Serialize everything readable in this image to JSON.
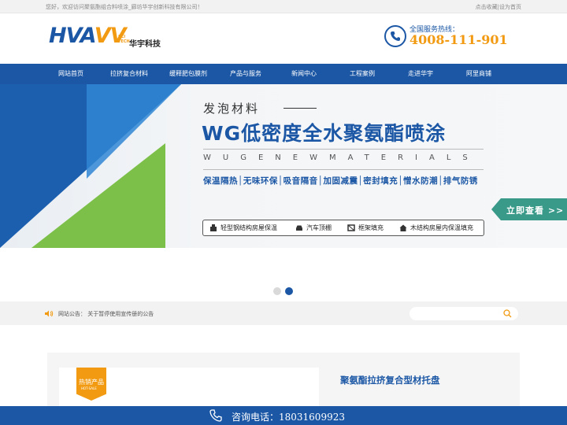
{
  "topbar": {
    "welcome": "您好，欢迎访问聚氨酯组合料喷涂_廊坊华宇创新科技有限公司！",
    "favorite": "点击收藏|设为首页"
  },
  "logo": {
    "brand_a": "HVA",
    "brand_b": "VV",
    "sci_line1": "SCI",
    "sci_line2": "TECH",
    "cn_name": "华宇科技"
  },
  "hotline": {
    "label": "全国服务热线：",
    "number": "4008-111-901"
  },
  "nav": {
    "items": [
      {
        "label": "网站首页"
      },
      {
        "label": "拉挤复合材料"
      },
      {
        "label": "缓释肥包膜剂"
      },
      {
        "label": "产品与服务"
      },
      {
        "label": "新闻中心"
      },
      {
        "label": "工程案例"
      },
      {
        "label": "走进华宇"
      },
      {
        "label": "阿里商铺"
      }
    ]
  },
  "banner": {
    "subtitle": "发泡材料",
    "title": "WG低密度全水聚氨酯喷涂",
    "english": "WUGENEWMATERIALS",
    "features": "保温隔热│无味环保│吸音隔音│加固减震│密封填充│憎水防潮│排气防锈",
    "applications": [
      {
        "label": "轻型钢结构房屋保温",
        "icon": "building-icon"
      },
      {
        "label": "汽车顶棚",
        "icon": "car-icon"
      },
      {
        "label": "框架填充",
        "icon": "frame-icon"
      },
      {
        "label": "木结构房屋内保温填充",
        "icon": "house-icon"
      }
    ],
    "cta": "立即查看 >>"
  },
  "carousel": {
    "total": 2,
    "active": 2
  },
  "notice": {
    "text": "网站公告： 关于暂停使用宣传册的公告",
    "search_placeholder": ""
  },
  "product": {
    "badge_cn": "热销产品",
    "badge_en": "HOT-SALE",
    "name": "聚氨酯拉挤复合型材托盘"
  },
  "consult": {
    "text": "咨询电话：18031609923"
  },
  "colors": {
    "primary": "#1b57a5",
    "accent": "#f19a12",
    "green": "#7cc04a",
    "teal": "#3a9a8a"
  }
}
